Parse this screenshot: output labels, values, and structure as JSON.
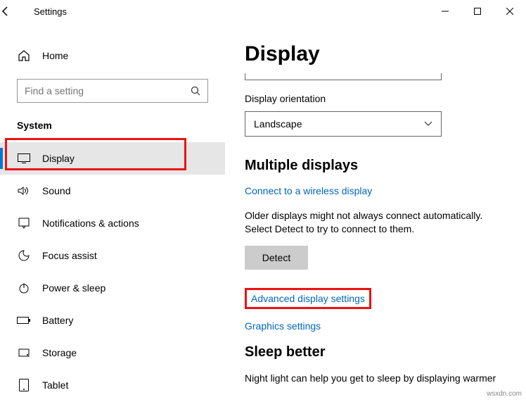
{
  "window": {
    "title": "Settings"
  },
  "sidebar": {
    "home": "Home",
    "search_placeholder": "Find a setting",
    "heading": "System",
    "items": [
      {
        "label": "Display"
      },
      {
        "label": "Sound"
      },
      {
        "label": "Notifications & actions"
      },
      {
        "label": "Focus assist"
      },
      {
        "label": "Power & sleep"
      },
      {
        "label": "Battery"
      },
      {
        "label": "Storage"
      },
      {
        "label": "Tablet"
      }
    ]
  },
  "main": {
    "title": "Display",
    "orientation_label": "Display orientation",
    "orientation_value": "Landscape",
    "multiple_heading": "Multiple displays",
    "wireless_link": "Connect to a wireless display",
    "older_text": "Older displays might not always connect automatically. Select Detect to try to connect to them.",
    "detect_label": "Detect",
    "advanced_link": "Advanced display settings",
    "graphics_link": "Graphics settings",
    "sleep_heading": "Sleep better",
    "sleep_text": "Night light can help you get to sleep by displaying warmer"
  },
  "watermark": "wsxdn.com"
}
